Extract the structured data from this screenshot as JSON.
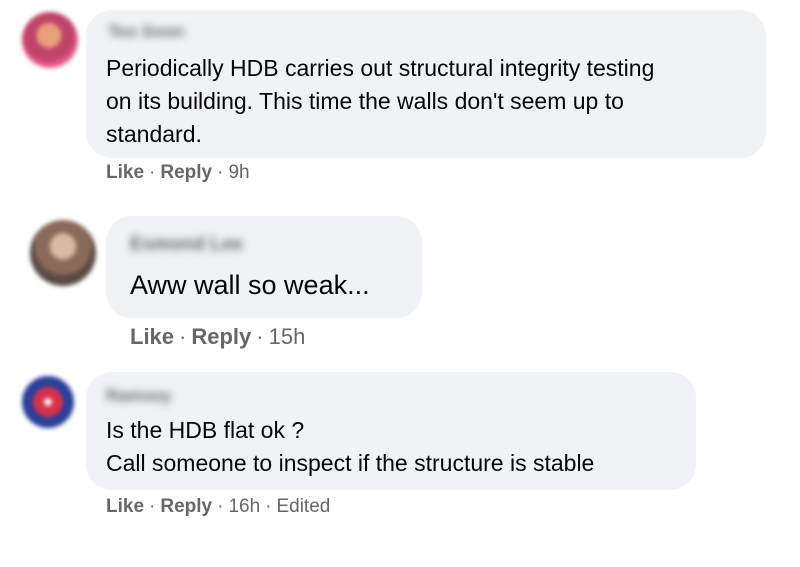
{
  "comments": [
    {
      "author": "Teo Soon",
      "lines": [
        "Periodically HDB carries out structural integrity testing",
        "on its building. This time the walls don't seem up to",
        "standard."
      ],
      "actions": {
        "like": "Like",
        "reply": "Reply",
        "time": "9h",
        "edited": ""
      }
    },
    {
      "author": "Esmond Lee",
      "lines": [
        "Aww wall so weak..."
      ],
      "actions": {
        "like": "Like",
        "reply": "Reply",
        "time": "15h",
        "edited": ""
      }
    },
    {
      "author": "Ramsey",
      "lines": [
        "Is the HDB flat ok ?",
        "Call someone to inspect if the structure is stable"
      ],
      "actions": {
        "like": "Like",
        "reply": "Reply",
        "time": "16h",
        "edited": "Edited"
      }
    }
  ]
}
